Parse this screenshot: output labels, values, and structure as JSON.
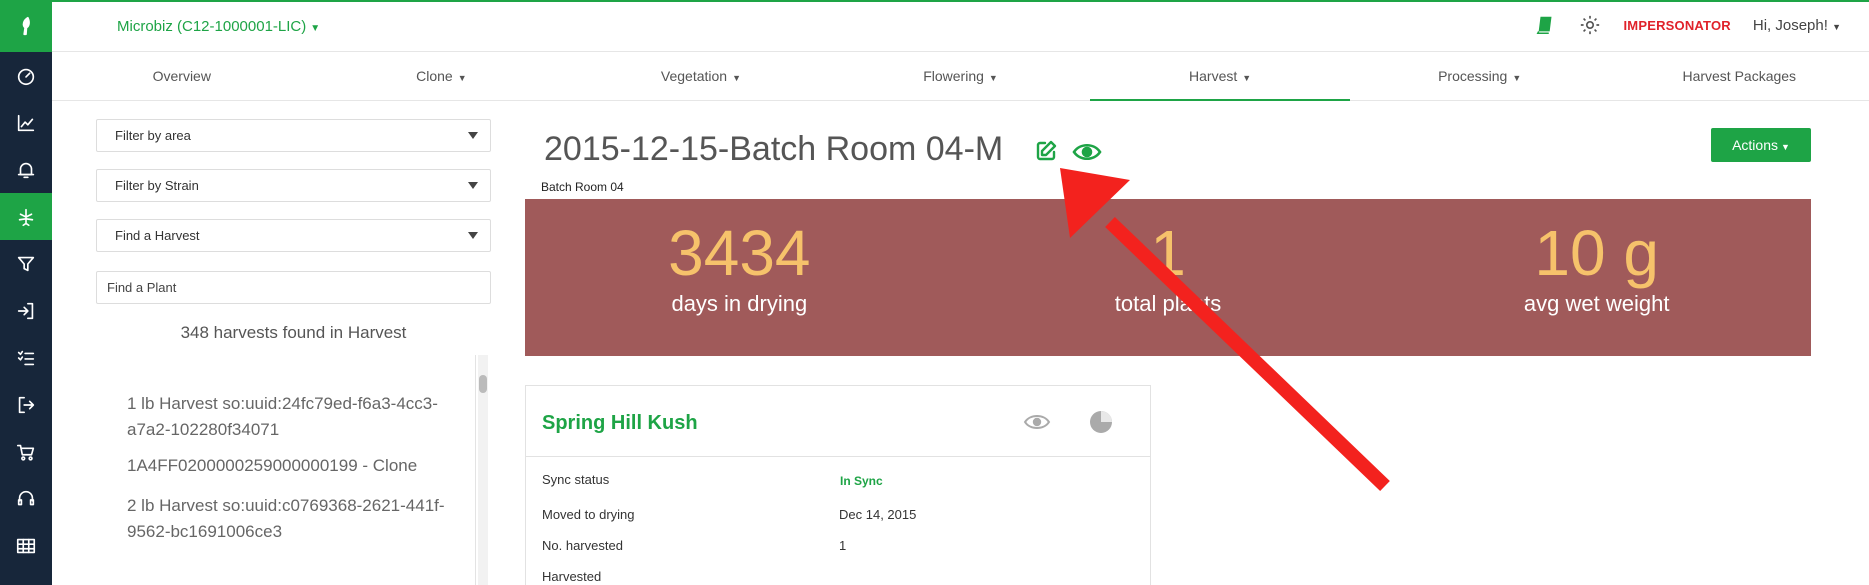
{
  "header": {
    "org": "Microbiz (C12-1000001-LIC)",
    "impersonator": "IMPERSONATOR",
    "greeting": "Hi, Joseph!"
  },
  "tabs": [
    {
      "label": "Overview"
    },
    {
      "label": "Clone"
    },
    {
      "label": "Vegetation"
    },
    {
      "label": "Flowering"
    },
    {
      "label": "Harvest"
    },
    {
      "label": "Processing"
    },
    {
      "label": "Harvest Packages"
    }
  ],
  "sidebar": {
    "filter_area": "Filter by area",
    "filter_strain": "Filter by Strain",
    "find_harvest": "Find a Harvest",
    "find_plant_placeholder": "Find a Plant",
    "count": "348 harvests found in Harvest",
    "list": [
      "1 lb Harvest so:uuid:24fc79ed-f6a3-4cc3-a7a2-102280f34071",
      "1A4FF0200000259000000199 - Clone",
      "2 lb Harvest so:uuid:c0769368-2621-441f-9562-bc1691006ce3"
    ]
  },
  "main": {
    "title": "2015-12-15-Batch Room 04-M",
    "room": "Batch Room 04",
    "actions_label": "Actions",
    "stats": [
      {
        "value": "3434",
        "label": "days in drying"
      },
      {
        "value": "1",
        "label": "total plants"
      },
      {
        "value": "10 g",
        "label": "avg wet weight"
      }
    ]
  },
  "card": {
    "strain": "Spring Hill Kush",
    "rows": [
      {
        "label": "Sync status",
        "value": "In Sync"
      },
      {
        "label": "Moved to drying",
        "value": "Dec 14, 2015"
      },
      {
        "label": "No. harvested",
        "value": "1"
      },
      {
        "label": "Harvested",
        "value": ""
      }
    ]
  },
  "colors": {
    "brand_green": "#1ea446",
    "rail_bg": "#17263a",
    "stats_bg": "#a05a5a",
    "stats_number": "#f6c26b",
    "annotation_red": "#f3221e"
  }
}
